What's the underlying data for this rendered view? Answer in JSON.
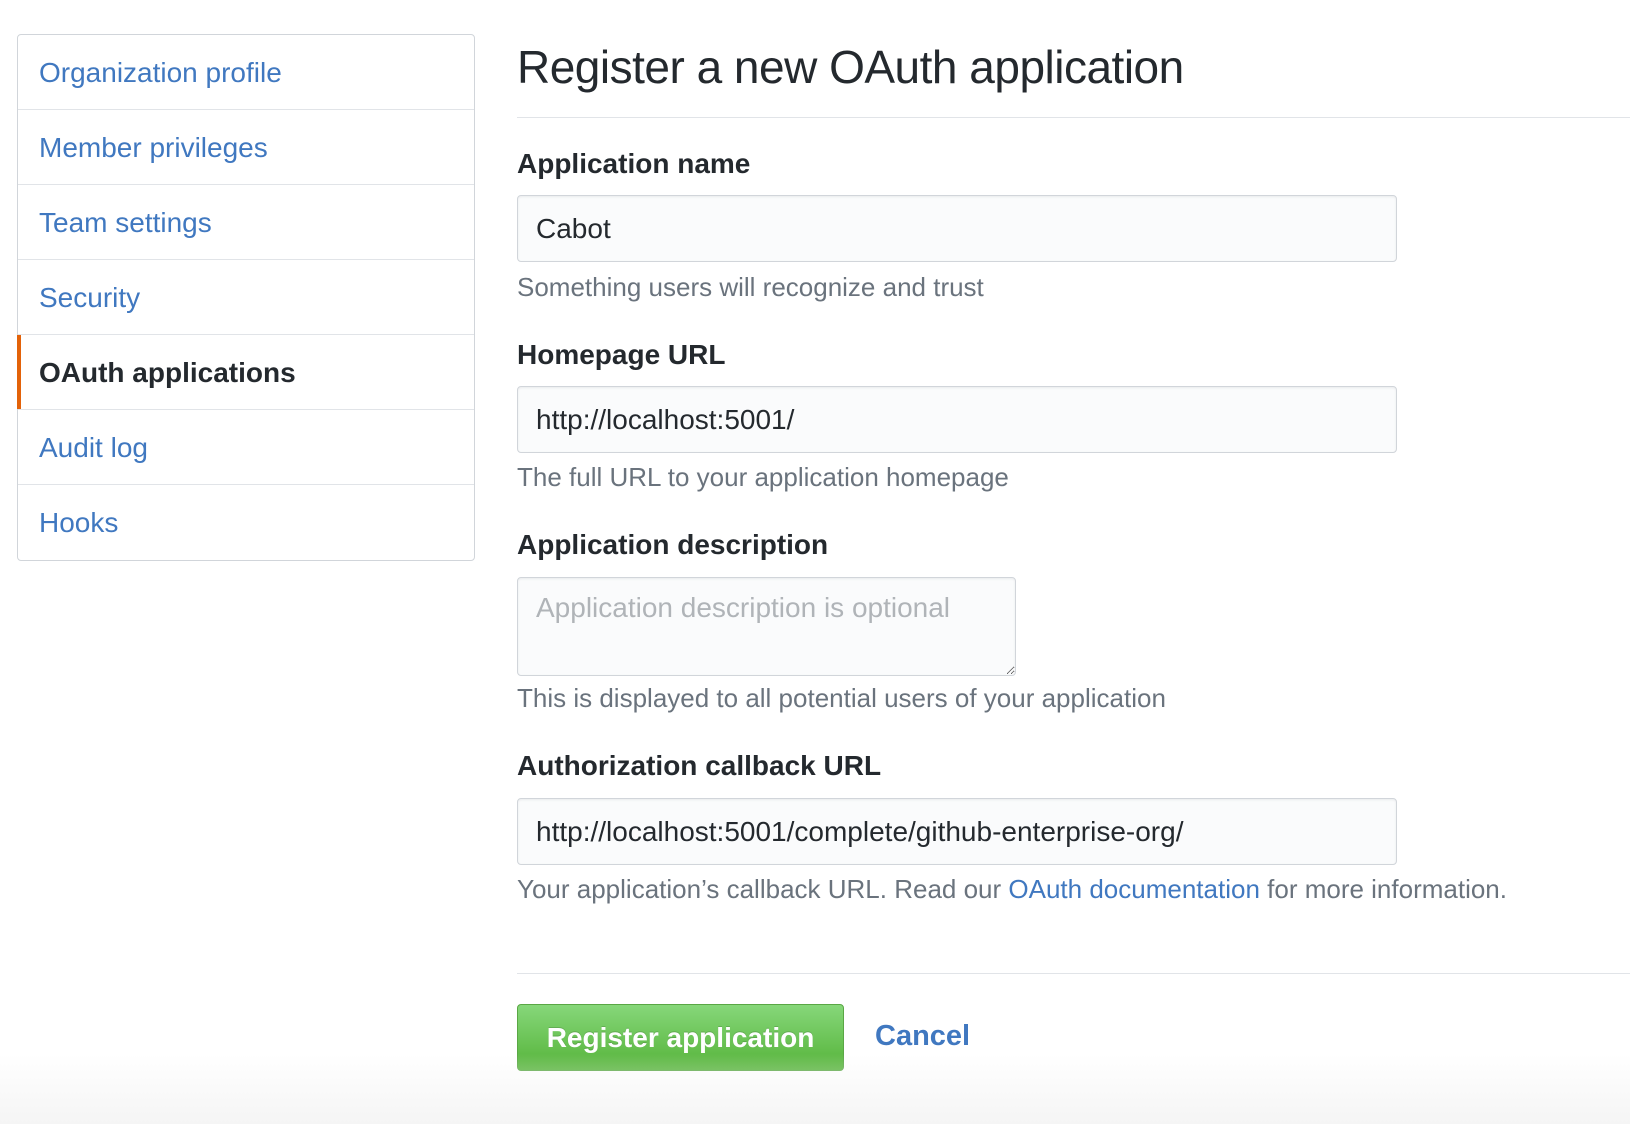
{
  "sidebar": {
    "items": [
      {
        "label": "Organization profile"
      },
      {
        "label": "Member privileges"
      },
      {
        "label": "Team settings"
      },
      {
        "label": "Security"
      },
      {
        "label": "OAuth applications"
      },
      {
        "label": "Audit log"
      },
      {
        "label": "Hooks"
      }
    ],
    "selected_index": 4
  },
  "page": {
    "title": "Register a new OAuth application"
  },
  "form": {
    "app_name": {
      "label": "Application name",
      "value": "Cabot",
      "note": "Something users will recognize and trust"
    },
    "homepage_url": {
      "label": "Homepage URL",
      "value": "http://localhost:5001/",
      "note": "The full URL to your application homepage"
    },
    "description": {
      "label": "Application description",
      "placeholder": "Application description is optional",
      "note": "This is displayed to all potential users of your application"
    },
    "callback_url": {
      "label": "Authorization callback URL",
      "value": "http://localhost:5001/complete/github-enterprise-org/",
      "note_before": "Your application’s callback URL. Read our ",
      "note_link": "OAuth documentation",
      "note_after": " for more information."
    }
  },
  "actions": {
    "register_label": "Register application",
    "cancel_label": "Cancel"
  },
  "colors": {
    "link": "#4078c0",
    "selected_accent": "#e36209",
    "primary_button": "#55b339"
  }
}
